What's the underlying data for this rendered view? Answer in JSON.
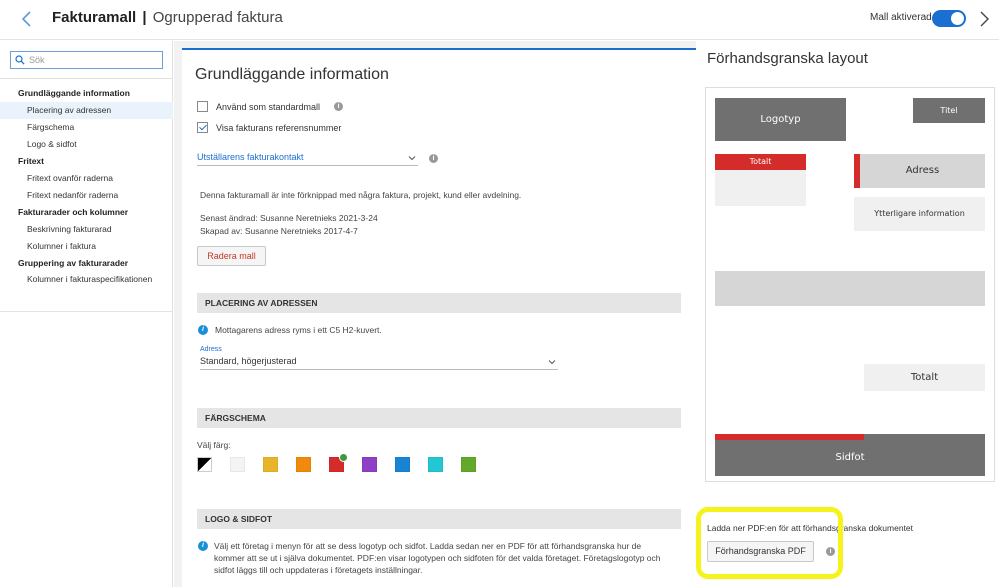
{
  "header": {
    "title_bold": "Fakturamall",
    "separator": "|",
    "title_sub": "Ogrupperad faktura",
    "toggle_label": "Mall aktiverad",
    "toggle_on": true
  },
  "sidebar": {
    "search_placeholder": "Sök",
    "groups": [
      {
        "label": "Grundläggande information",
        "items": [
          "Placering av adressen",
          "Färgschema",
          "Logo & sidfot"
        ]
      },
      {
        "label": "Fritext",
        "items": [
          "Fritext ovanför raderna",
          "Fritext nedanför raderna"
        ]
      },
      {
        "label": "Fakturarader och kolumner",
        "items": [
          "Beskrivning fakturarad",
          "Kolumner i faktura"
        ]
      },
      {
        "label": "Gruppering av fakturarader",
        "items": [
          "Kolumner i fakturaspecifikationen"
        ]
      }
    ],
    "active_item": "Placering av adressen"
  },
  "main": {
    "title": "Grundläggande information",
    "checkbox_standard": {
      "label": "Använd som standardmall",
      "checked": false
    },
    "checkbox_ref": {
      "label": "Visa fakturans referensnummer",
      "checked": true
    },
    "contact_select": "Utställarens fakturakontakt",
    "not_linked_text": "Denna fakturamall är inte förknippad med några faktura, projekt, kund eller avdelning.",
    "last_changed": "Senast ändrad: Susanne Neretnieks 2021-3-24",
    "created_by": "Skapad av: Susanne Neretnieks 2017-4-7",
    "delete_button": "Radera mall",
    "address_section": {
      "header": "PLACERING AV ADRESSEN",
      "info": "Mottagarens adress ryms i ett C5 H2-kuvert.",
      "field_label": "Adress",
      "field_value": "Standard, högerjusterad"
    },
    "color_section": {
      "header": "FÄRGSCHEMA",
      "choose_label": "Välj färg:",
      "swatches": [
        "#000000",
        "#f4f4f4",
        "#e8b52a",
        "#f08a0c",
        "#d42b2b",
        "#8e3fc6",
        "#1a84d4",
        "#23c7d4",
        "#62a82a"
      ],
      "selected_index": 4
    },
    "logo_section": {
      "header": "LOGO & SIDFOT",
      "info_lines": [
        "Välj ett företag i menyn för att se dess logotyp och sidfot. Ladda sedan ner en PDF för att förhandsgranska hur de",
        "kommer att se ut i själva dokumentet. PDF:en visar logotypen och sidfoten för det valda företaget. Företagslogotyp och",
        "sidfot läggs till och uppdateras i företagets inställningar."
      ]
    }
  },
  "preview": {
    "title": "Förhandsgranska layout",
    "logotyp": "Logotyp",
    "titel": "Titel",
    "totalt_red": "Totalt",
    "adress": "Adress",
    "extra_info": "Ytterligare information",
    "totalt": "Totalt",
    "sidfot": "Sidfot",
    "accent_color": "#d42b2b",
    "pdf_text": "Ladda ner PDF:en för att förhandsgranska dokumentet",
    "pdf_button": "Förhandsgranska PDF"
  }
}
